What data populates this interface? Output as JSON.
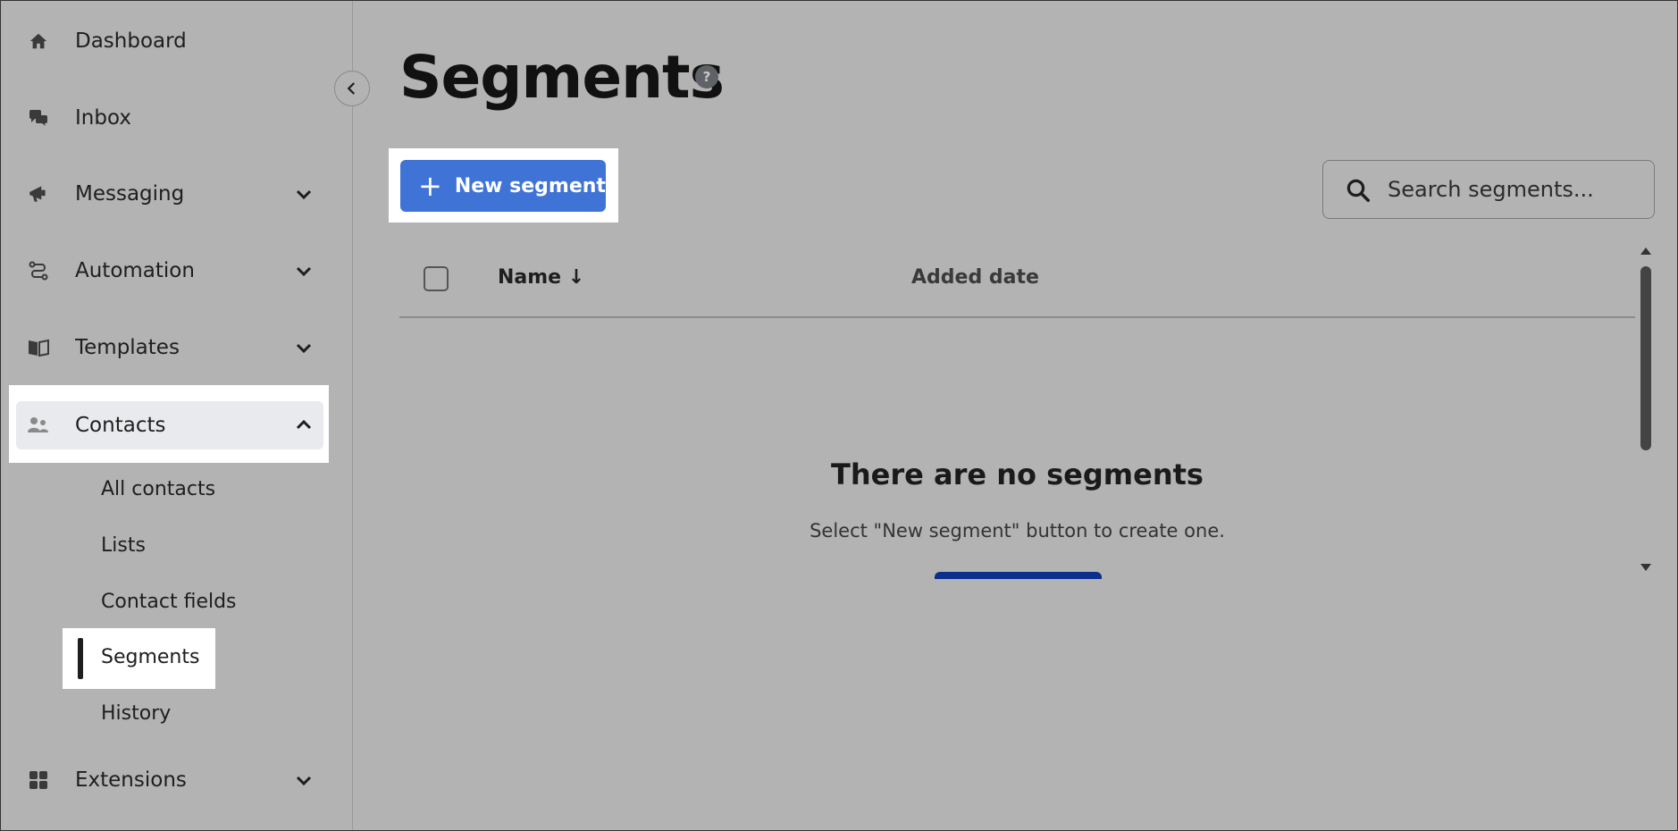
{
  "sidebar": {
    "items": [
      {
        "label": "Dashboard",
        "icon": "home-icon"
      },
      {
        "label": "Inbox",
        "icon": "chat-icon"
      },
      {
        "label": "Messaging",
        "icon": "megaphone-icon"
      },
      {
        "label": "Automation",
        "icon": "flow-icon"
      },
      {
        "label": "Templates",
        "icon": "book-icon"
      },
      {
        "label": "Contacts",
        "icon": "people-icon"
      },
      {
        "label": "Extensions",
        "icon": "grid-icon"
      }
    ],
    "contacts_sub": [
      "All contacts",
      "Lists",
      "Contact fields",
      "Segments",
      "History"
    ]
  },
  "main": {
    "title": "Segments",
    "help": "?",
    "new_button": "New segment",
    "search_placeholder": "Search segments...",
    "columns": {
      "name": "Name",
      "sort_arrow": "↓",
      "added": "Added date"
    },
    "empty_title": "There are no segments",
    "empty_sub": "Select \"New segment\" button to create one."
  },
  "colors": {
    "accent": "#3f74d6",
    "background": "#b3b3b3"
  }
}
